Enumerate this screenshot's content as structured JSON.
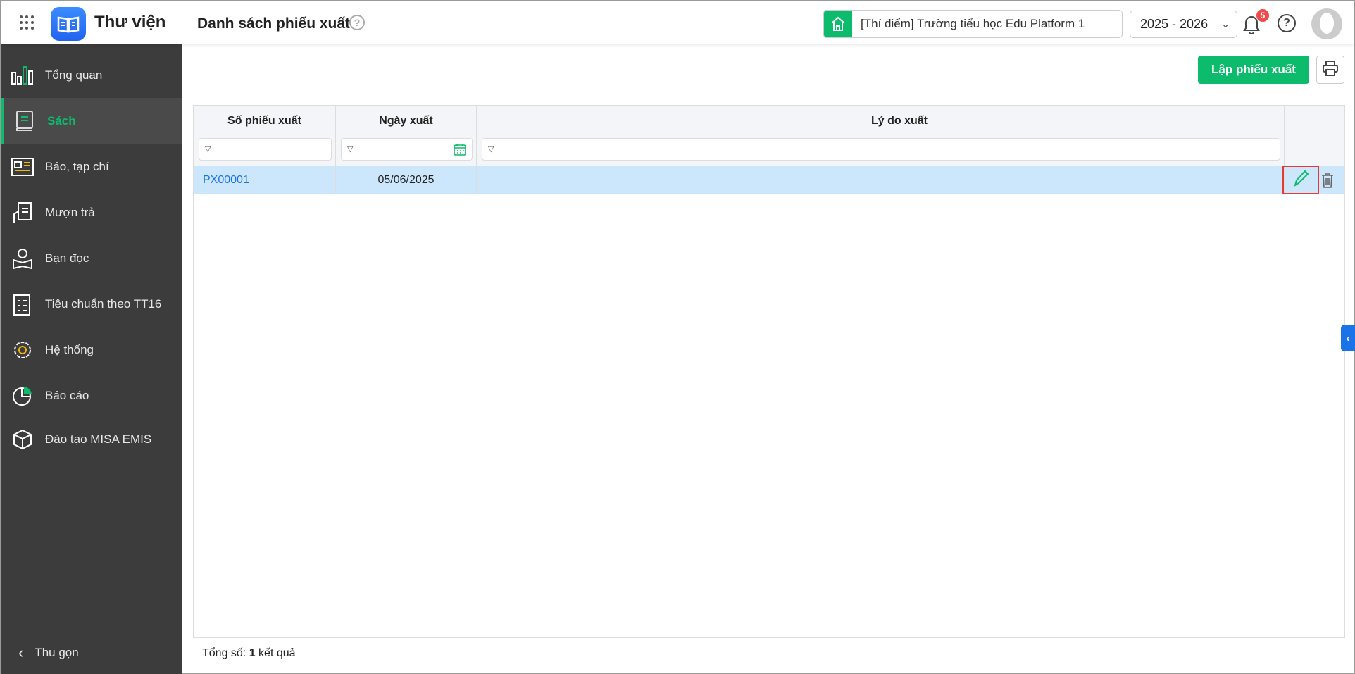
{
  "header": {
    "app_title": "Thư viện",
    "page_title": "Danh sách phiếu xuất",
    "help_glyph": "?",
    "school": "[Thí điểm] Trường tiểu học Edu Platform 1",
    "year": "2025 - 2026",
    "notification_count": "5"
  },
  "sidebar": {
    "items": [
      {
        "label": "Tổng quan",
        "icon": "chart-icon"
      },
      {
        "label": "Sách",
        "icon": "book-icon",
        "active": true
      },
      {
        "label": "Báo, tạp chí",
        "icon": "newspaper-icon"
      },
      {
        "label": "Mượn trả",
        "icon": "borrow-icon"
      },
      {
        "label": "Bạn đọc",
        "icon": "reader-icon"
      },
      {
        "label": "Tiêu chuẩn theo TT16",
        "icon": "checklist-icon"
      },
      {
        "label": "Hệ thống",
        "icon": "gear-icon"
      },
      {
        "label": "Báo cáo",
        "icon": "pie-chart-icon"
      },
      {
        "label": "Đào tạo MISA EMIS",
        "icon": "cube-icon"
      }
    ],
    "collapse_label": "Thu gọn"
  },
  "toolbar": {
    "create_label": "Lập phiếu xuất"
  },
  "table": {
    "columns": [
      "Số phiếu xuất",
      "Ngày xuất",
      "Lý do xuất"
    ],
    "rows": [
      {
        "code": "PX00001",
        "date": "05/06/2025",
        "reason": ""
      }
    ]
  },
  "footer": {
    "prefix": "Tổng số: ",
    "count": "1",
    "suffix": " kết quả"
  },
  "colors": {
    "accent": "#0cbb6b",
    "sidebar": "#3c3c3c",
    "selected_row": "#cce6fb",
    "link": "#1a73e8"
  }
}
